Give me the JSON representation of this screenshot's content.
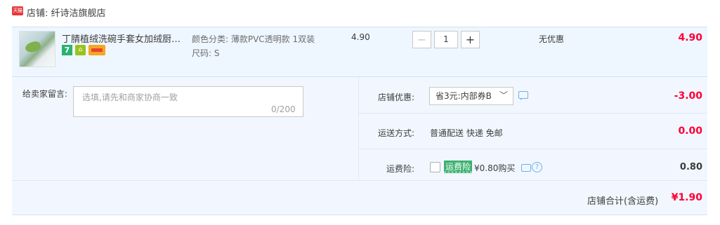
{
  "shop": {
    "badge": "天猫",
    "name": "店铺: 纤诗洁旗舰店"
  },
  "item": {
    "title": "丁腈植绒洗碗手套女加绒厨房家...",
    "badge_7": "7",
    "attr_color": "颜色分类: 薄款PVC透明款 1双装",
    "attr_size": "尺码: S",
    "unit_price": "4.90",
    "quantity": "1",
    "qty_minus": "−",
    "qty_plus": "+",
    "promotion": "无优惠",
    "subtotal": "4.90"
  },
  "message": {
    "label": "给卖家留言:",
    "placeholder": "选填,请先和商家协商一致",
    "counter": "0/200"
  },
  "discount": {
    "label": "店铺优惠:",
    "selected": "省3元:内部券B",
    "value": "-3.00"
  },
  "shipping": {
    "label": "运送方式:",
    "method": "普通配送 快递 免邮",
    "value": "0.00"
  },
  "insurance": {
    "label": "运费险:",
    "tag": "运费险",
    "price_text": "¥0.80购买",
    "value": "0.80"
  },
  "total": {
    "label": "店铺合计(含运费)",
    "value": "¥1.90"
  },
  "colors": {
    "price_red": "#ff0036",
    "panel_bg": "#f2f7ff",
    "item_bg": "#eef6ff",
    "insurance_green": "#3cb06f"
  }
}
